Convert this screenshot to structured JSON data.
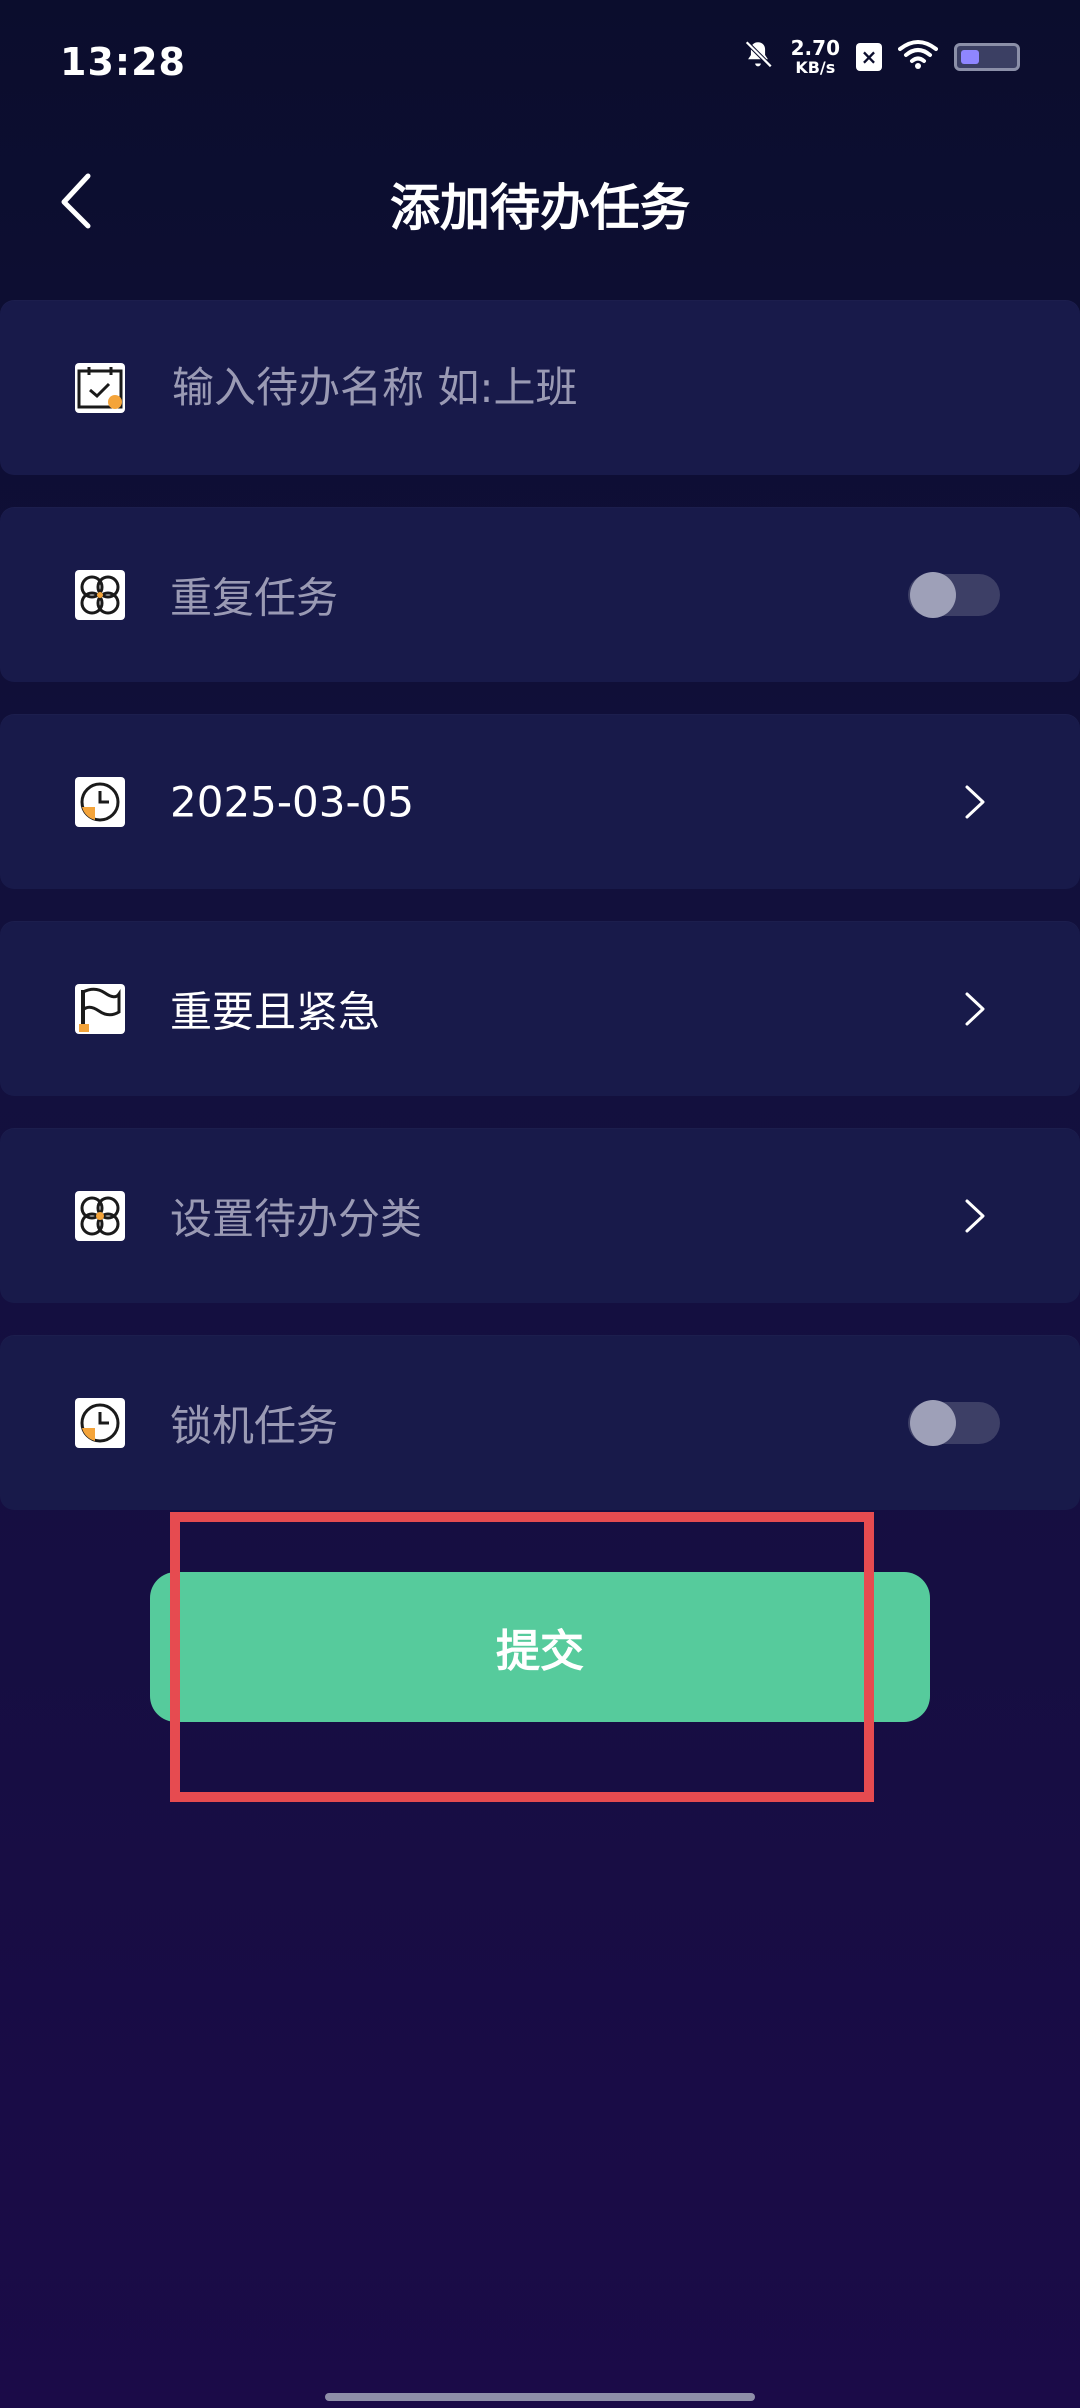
{
  "status_bar": {
    "time": "13:28",
    "net_speed": "2.70",
    "net_unit": "KB/s",
    "battery_level": 0.35
  },
  "header": {
    "title": "添加待办任务"
  },
  "form": {
    "task_name_placeholder": "输入待办名称 如:上班",
    "task_name_value": "",
    "repeat_label": "重复任务",
    "repeat_enabled": false,
    "date_value": "2025-03-05",
    "priority_value": "重要且紧急",
    "category_placeholder": "设置待办分类",
    "lock_label": "锁机任务",
    "lock_enabled": false
  },
  "submit": {
    "label": "提交"
  },
  "colors": {
    "background": "#12103d",
    "row_background": "#181a4a",
    "accent_green": "#56cb9c",
    "highlight_red": "#e64b50",
    "icon_accent_orange": "#f4a43a"
  },
  "icons": {
    "back": "chevron-left-icon",
    "task": "calendar-check-icon",
    "repeat": "clover-grid-icon",
    "date": "clock-icon",
    "priority": "flag-icon",
    "category": "clover-grid-icon",
    "lock": "clock-icon",
    "row_chevron": "chevron-right-icon"
  }
}
